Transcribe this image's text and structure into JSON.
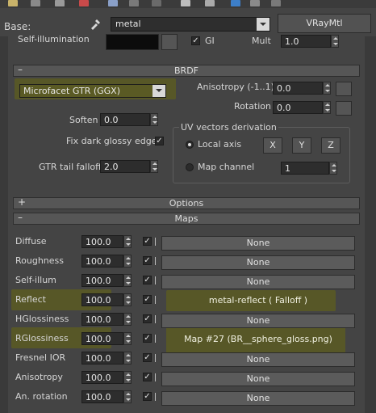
{
  "header": {
    "base_label": "Base:",
    "material_name": "metal",
    "material_type": "VRayMtl"
  },
  "top_cut": {
    "self_illum_label": "Self-illumination",
    "gi_label": "GI",
    "mult_label": "Mult",
    "mult_value": "1.0"
  },
  "brdf": {
    "title": "BRDF",
    "brdf_type": "Microfacet GTR (GGX)",
    "anisotropy_label": "Anisotropy (-1..1)",
    "anisotropy_value": "0.0",
    "rotation_label": "Rotation",
    "rotation_value": "0.0",
    "soften_label": "Soften",
    "soften_value": "0.0",
    "fix_dark_label": "Fix dark glossy edges",
    "fix_dark_checked": "✓",
    "gtr_label": "GTR tail falloff",
    "gtr_value": "2.0",
    "uv_group_label": "UV vectors derivation",
    "local_axis_label": "Local axis",
    "axis_x": "X",
    "axis_y": "Y",
    "axis_z": "Z",
    "map_channel_label": "Map channel",
    "map_channel_value": "1"
  },
  "options": {
    "title": "Options"
  },
  "maps": {
    "title": "Maps",
    "rows": [
      {
        "label": "Diffuse",
        "amount": "100.0",
        "check": "✓",
        "map": "None"
      },
      {
        "label": "Roughness",
        "amount": "100.0",
        "check": "✓",
        "map": "None"
      },
      {
        "label": "Self-illum",
        "amount": "100.0",
        "check": "✓",
        "map": "None"
      },
      {
        "label": "Reflect",
        "amount": "100.0",
        "check": "✓",
        "map": "metal-reflect  ( Falloff )"
      },
      {
        "label": "HGlossiness",
        "amount": "100.0",
        "check": "✓",
        "map": "None"
      },
      {
        "label": "RGlossiness",
        "amount": "100.0",
        "check": "✓",
        "map": "Map #27 (BR__sphere_gloss.png)"
      },
      {
        "label": "Fresnel IOR",
        "amount": "100.0",
        "check": "✓",
        "map": "None"
      },
      {
        "label": "Anisotropy",
        "amount": "100.0",
        "check": "✓",
        "map": "None"
      },
      {
        "label": "An. rotation",
        "amount": "100.0",
        "check": "✓",
        "map": "None"
      }
    ]
  },
  "colors": {
    "panel_bg": "#444444",
    "highlight": "#5b5b22",
    "toolbar_bg": "#3b3b3b"
  }
}
